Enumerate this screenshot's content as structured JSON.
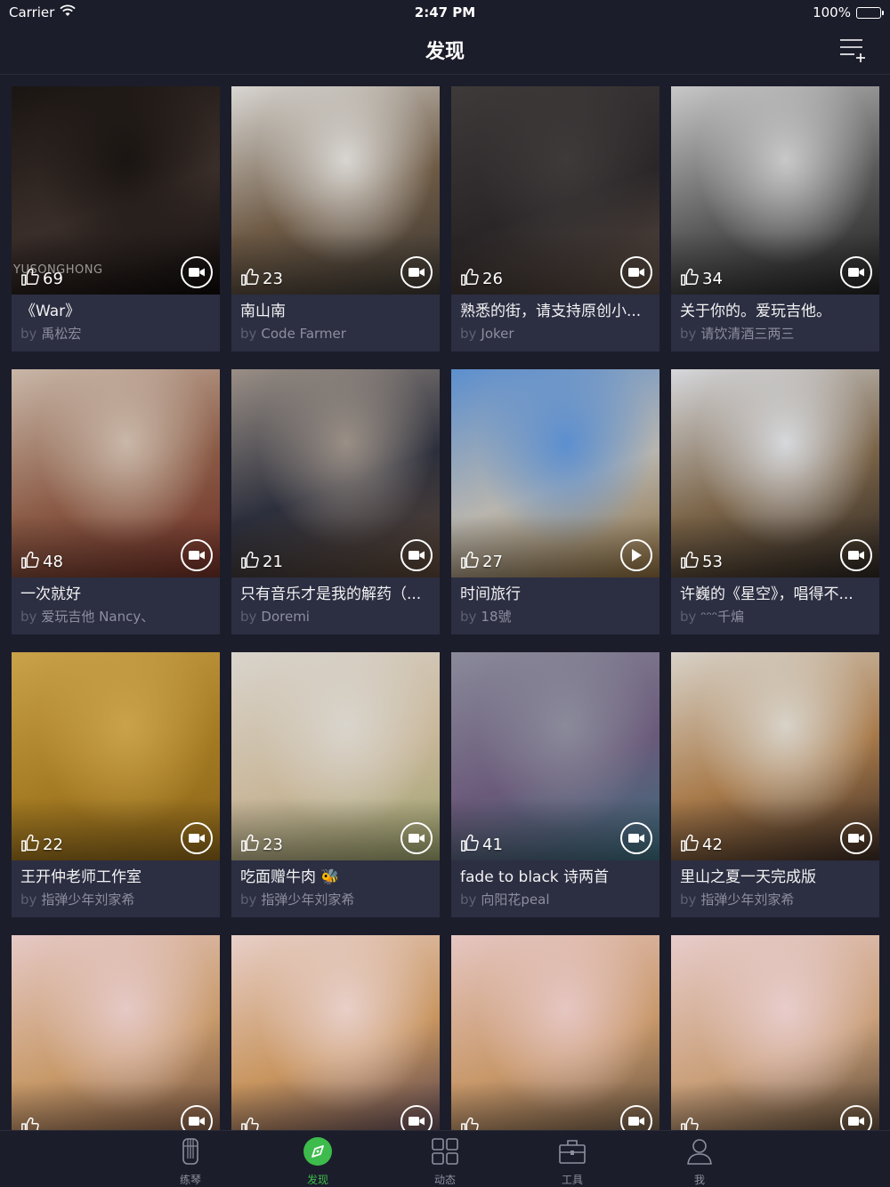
{
  "status_bar": {
    "carrier": "Carrier",
    "time": "2:47 PM",
    "battery": "100%"
  },
  "nav": {
    "title": "发现",
    "menu_icon": "list-add-icon"
  },
  "by_label": "by",
  "cards": [
    {
      "likes": "69",
      "title": "《War》",
      "author": "禹松宏",
      "media": "video",
      "watermark": "YUSONGHONG",
      "colors": [
        "#1a1512",
        "#3a2e2a",
        "#0d0a09"
      ]
    },
    {
      "likes": "23",
      "title": "南山南",
      "author": "Code Farmer",
      "media": "video",
      "colors": [
        "#d8d6d2",
        "#6e5a45",
        "#3a3631"
      ]
    },
    {
      "likes": "26",
      "title": "熟悉的街，请支持原创小...",
      "author": "Joker",
      "media": "video",
      "colors": [
        "#3e3a3a",
        "#2a2628",
        "#5a4a40"
      ]
    },
    {
      "likes": "34",
      "title": "关于你的。爱玩吉他。",
      "author": "请饮清酒三两三",
      "media": "video",
      "colors": [
        "#c8c8c8",
        "#5a5a5a",
        "#1f1f1f"
      ]
    },
    {
      "likes": "48",
      "title": "一次就好",
      "author": "爱玩吉他 Nancy、",
      "media": "video",
      "colors": [
        "#c9b7a8",
        "#8a5a45",
        "#6d2e25"
      ]
    },
    {
      "likes": "21",
      "title": "只有音乐才是我的解药（...",
      "author": "Doremi",
      "media": "video",
      "colors": [
        "#9a8f86",
        "#2c2f3c",
        "#5a4535"
      ]
    },
    {
      "likes": "27",
      "title": "时间旅行",
      "author": "18號",
      "media": "play",
      "colors": [
        "#5c8fcf",
        "#b8b5ae",
        "#8a6a3a"
      ]
    },
    {
      "likes": "53",
      "title": "许巍的《星空》，唱得不...",
      "author": "ᵔᵔᵔ千煸",
      "media": "video",
      "colors": [
        "#d6d8dc",
        "#7a6347",
        "#2a2420"
      ]
    },
    {
      "likes": "22",
      "title": "王开仲老师工作室",
      "author": "指弹少年刘家希",
      "media": "video",
      "colors": [
        "#c9a24a",
        "#a47a22",
        "#8a6418"
      ]
    },
    {
      "likes": "23",
      "title": "吃面赠牛肉 🐝",
      "author": "指弹少年刘家希",
      "media": "video",
      "colors": [
        "#d9d4cc",
        "#c9b79a",
        "#9aa06a"
      ]
    },
    {
      "likes": "41",
      "title": "fade to black 诗两首",
      "author": "向阳花peal",
      "media": "video",
      "colors": [
        "#8a8a9a",
        "#6a5a7a",
        "#3a6a7a"
      ]
    },
    {
      "likes": "42",
      "title": "里山之夏一天完成版",
      "author": "指弹少年刘家希",
      "media": "video",
      "colors": [
        "#d8d2c8",
        "#a87a4a",
        "#3a2a22"
      ]
    },
    {
      "likes": "",
      "title": "",
      "author": "",
      "media": "video",
      "colors": [
        "#e6c9c6",
        "#c89a6a",
        "#6a4a3a"
      ]
    },
    {
      "likes": "",
      "title": "",
      "author": "",
      "media": "video",
      "colors": [
        "#e8cfc8",
        "#c8955f",
        "#4a3a4a"
      ]
    },
    {
      "likes": "",
      "title": "",
      "author": "",
      "media": "video",
      "colors": [
        "#e6c6c2",
        "#c8986a",
        "#5a4a3a"
      ]
    },
    {
      "likes": "",
      "title": "",
      "author": "",
      "media": "video",
      "colors": [
        "#e8cccb",
        "#caa07a",
        "#4a3a2a"
      ]
    }
  ],
  "tabs": [
    {
      "label": "练琴",
      "icon": "guitar-icon",
      "active": false
    },
    {
      "label": "发现",
      "icon": "compass-icon",
      "active": true
    },
    {
      "label": "动态",
      "icon": "grid-icon",
      "active": false
    },
    {
      "label": "工具",
      "icon": "toolbox-icon",
      "active": false
    },
    {
      "label": "我",
      "icon": "person-icon",
      "active": false
    }
  ],
  "accent_color": "#3dbb4c"
}
